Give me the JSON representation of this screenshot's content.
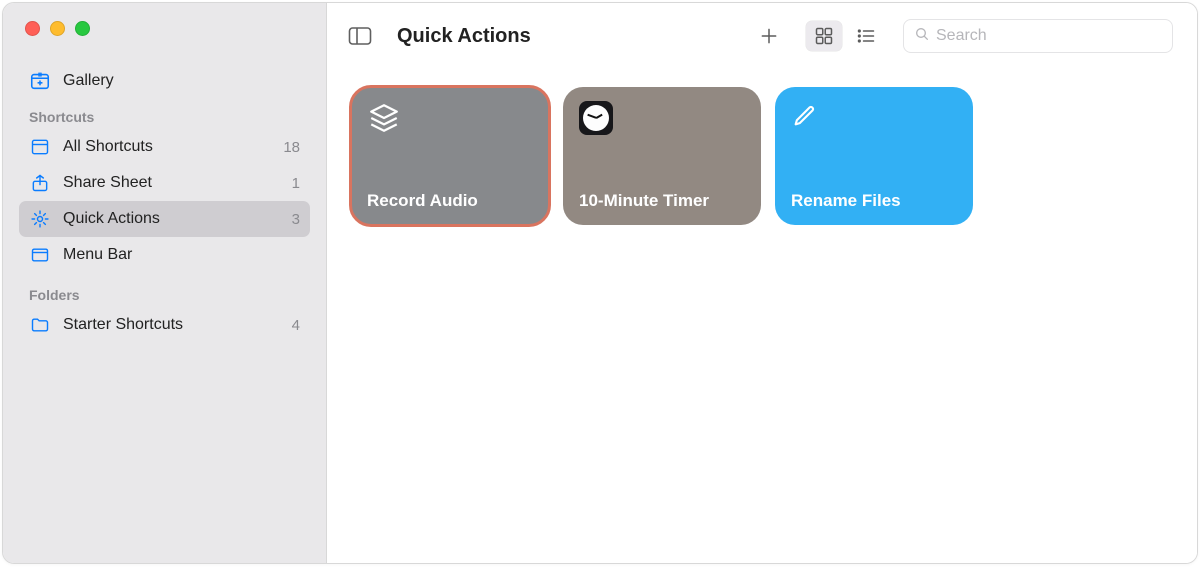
{
  "sidebar": {
    "gallery_label": "Gallery",
    "section_shortcuts": "Shortcuts",
    "section_folders": "Folders",
    "items": [
      {
        "label": "All Shortcuts",
        "count": "18"
      },
      {
        "label": "Share Sheet",
        "count": "1"
      },
      {
        "label": "Quick Actions",
        "count": "3"
      },
      {
        "label": "Menu Bar",
        "count": ""
      }
    ],
    "folders": [
      {
        "label": "Starter Shortcuts",
        "count": "4"
      }
    ]
  },
  "toolbar": {
    "title": "Quick Actions",
    "search_placeholder": "Search"
  },
  "cards": [
    {
      "title": "Record Audio",
      "color": "gray",
      "icon": "layers",
      "highlighted": true
    },
    {
      "title": "10-Minute Timer",
      "color": "taupe",
      "icon": "clock",
      "highlighted": false
    },
    {
      "title": "Rename Files",
      "color": "blue",
      "icon": "pencil",
      "highlighted": false
    }
  ]
}
